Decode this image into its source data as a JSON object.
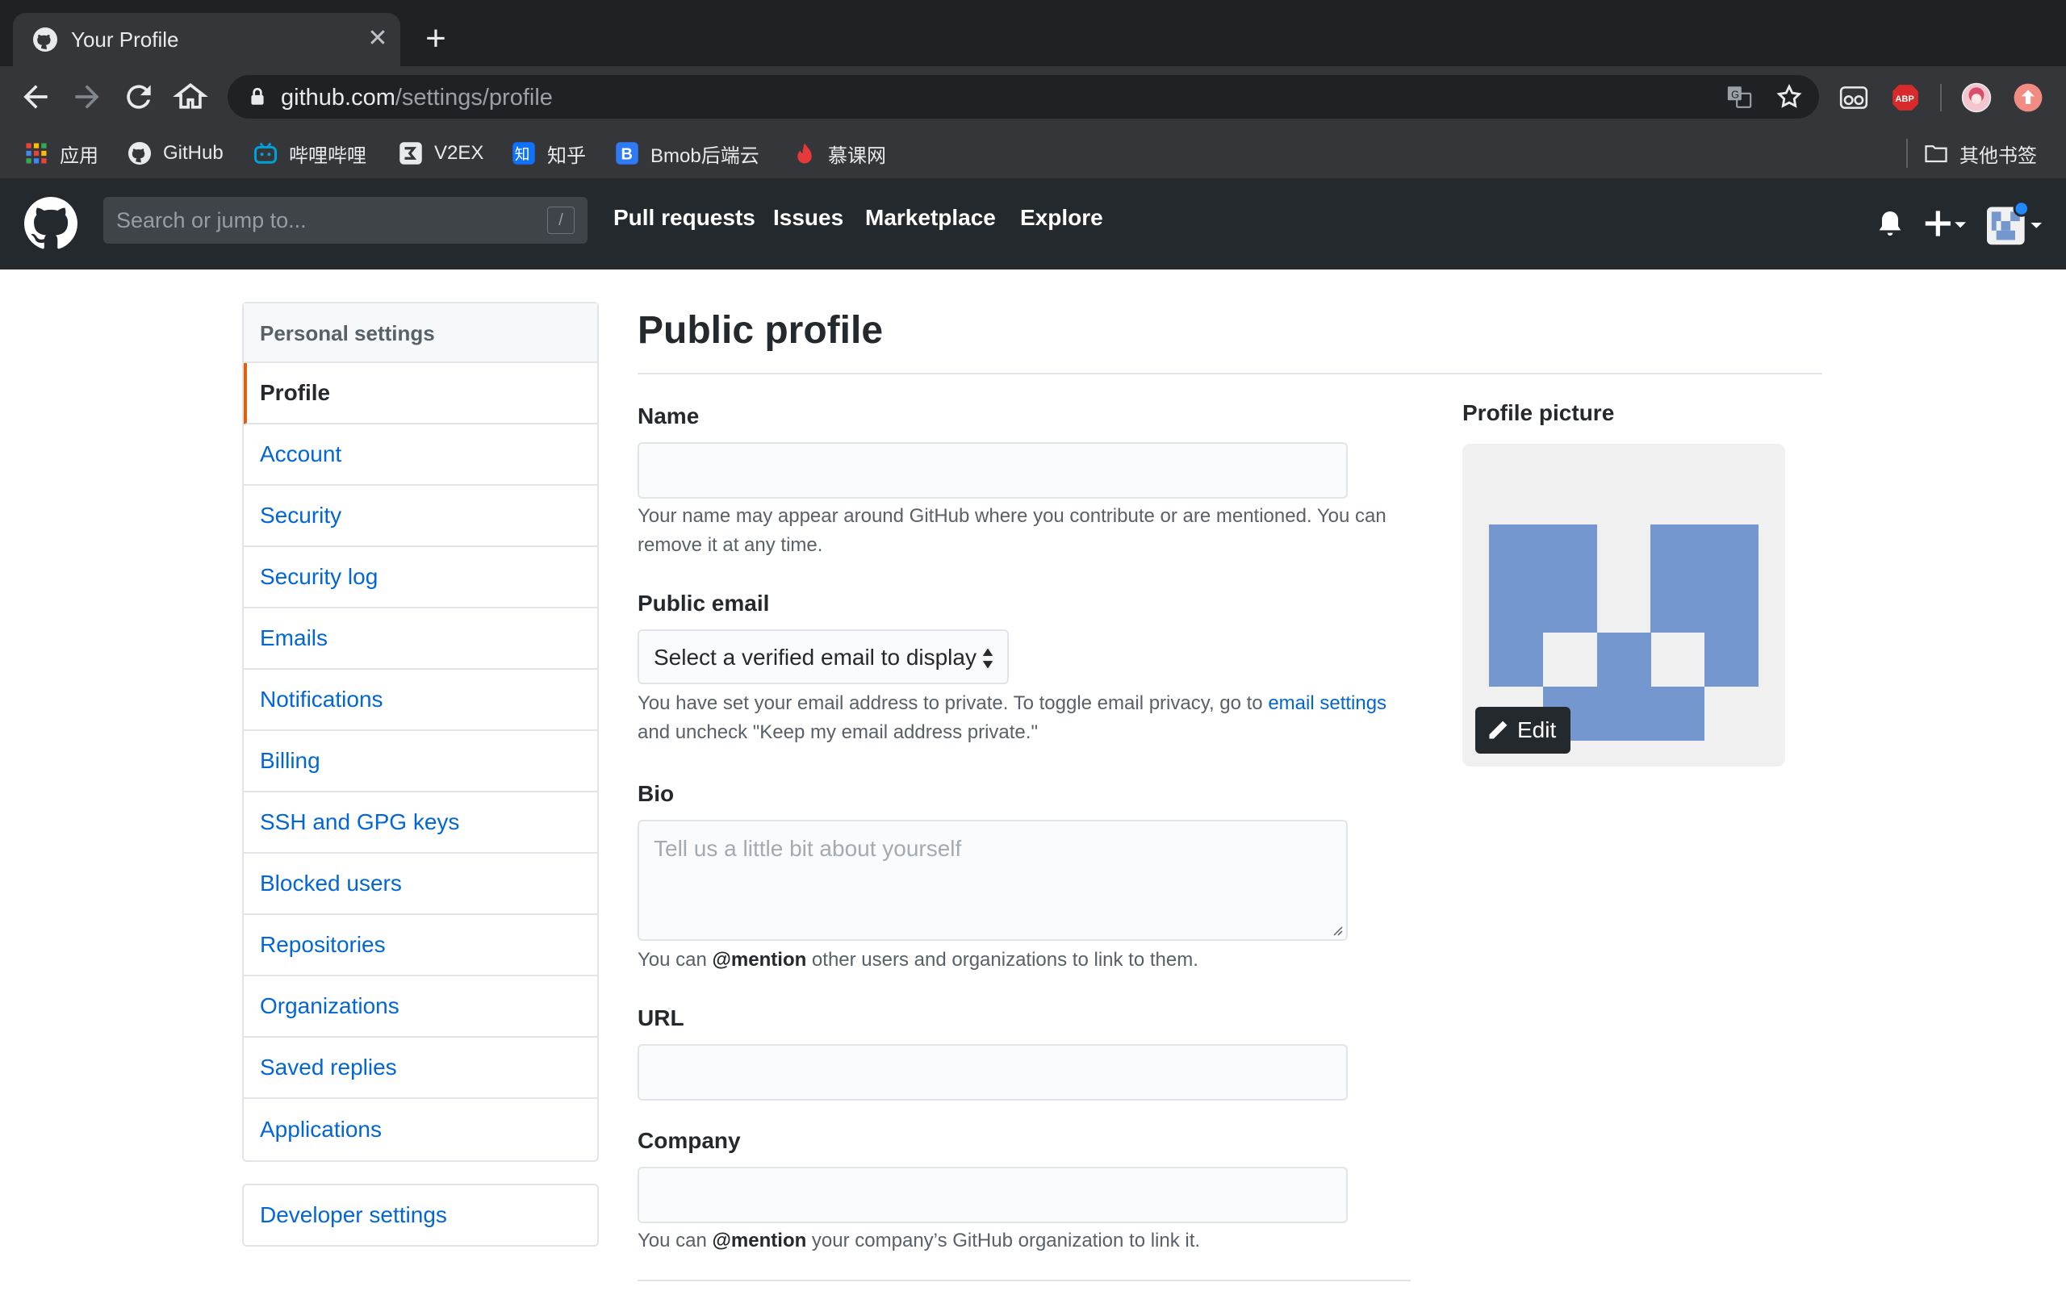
{
  "browser": {
    "tab_title": "Your Profile",
    "tab_close": "✕",
    "new_tab": "+",
    "url_host": "github.com",
    "url_path": "/settings/profile"
  },
  "bookmarks": {
    "items": [
      {
        "label": "应用",
        "icon": "apps-grid-icon"
      },
      {
        "label": "GitHub",
        "icon": "github-icon"
      },
      {
        "label": "哔哩哔哩",
        "icon": "bilibili-icon"
      },
      {
        "label": "V2EX",
        "icon": "v2ex-icon"
      },
      {
        "label": "知乎",
        "icon": "zhihu-icon"
      },
      {
        "label": "Bmob后端云",
        "icon": "bmob-icon"
      },
      {
        "label": "慕课网",
        "icon": "imooc-icon"
      }
    ],
    "other": "其他书签"
  },
  "github_header": {
    "search_placeholder": "Search or jump to...",
    "search_shortcut": "/",
    "nav": [
      "Pull requests",
      "Issues",
      "Marketplace",
      "Explore"
    ]
  },
  "sidebar": {
    "heading": "Personal settings",
    "items": [
      {
        "label": "Profile",
        "selected": true
      },
      {
        "label": "Account"
      },
      {
        "label": "Security"
      },
      {
        "label": "Security log"
      },
      {
        "label": "Emails"
      },
      {
        "label": "Notifications"
      },
      {
        "label": "Billing"
      },
      {
        "label": "SSH and GPG keys"
      },
      {
        "label": "Blocked users"
      },
      {
        "label": "Repositories"
      },
      {
        "label": "Organizations"
      },
      {
        "label": "Saved replies"
      },
      {
        "label": "Applications"
      }
    ],
    "developer_settings": "Developer settings"
  },
  "main": {
    "title": "Public profile",
    "name_label": "Name",
    "name_value": "",
    "name_note": "Your name may appear around GitHub where you contribute or are mentioned. You can remove it at any time.",
    "email_label": "Public email",
    "email_select": "Select a verified email to display",
    "email_note_before": "You have set your email address to private. To toggle email privacy, go to ",
    "email_note_link": "email settings",
    "email_note_after": " and uncheck \"Keep my email address private.\"",
    "bio_label": "Bio",
    "bio_placeholder": "Tell us a little bit about yourself",
    "bio_note_before": "You can ",
    "bio_note_bold": "@mention",
    "bio_note_after": " other users and organizations to link to them.",
    "url_label": "URL",
    "company_label": "Company",
    "company_note_before": "You can ",
    "company_note_bold": "@mention",
    "company_note_after": " your company’s GitHub organization to link it."
  },
  "profile_picture": {
    "label": "Profile picture",
    "edit_label": "Edit",
    "identicon_color": "#7597cf"
  },
  "colors": {
    "link": "#0366d6",
    "selected_accent": "#e36209",
    "header_bg": "#24292e"
  }
}
